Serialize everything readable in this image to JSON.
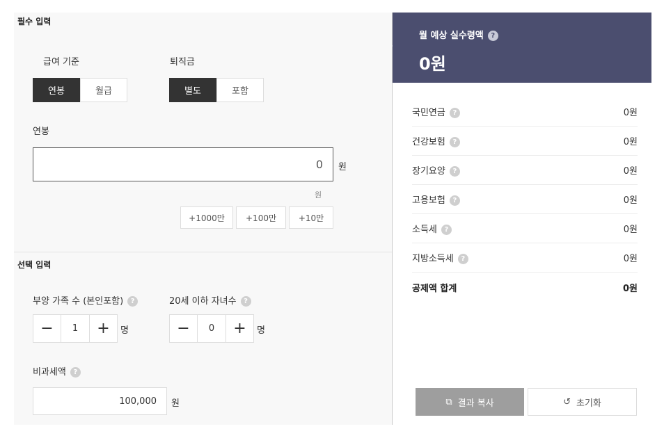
{
  "required": {
    "section_title": "필수 입력",
    "pay_basis": {
      "label": "급여 기준",
      "options": [
        "연봉",
        "월급"
      ],
      "selected": "연봉"
    },
    "severance": {
      "label": "퇴직금",
      "options": [
        "별도",
        "포함"
      ],
      "selected": "별도"
    },
    "salary": {
      "label": "연봉",
      "value": "0",
      "unit": "원",
      "sub_unit": "원"
    },
    "quick_add": [
      "+1000만",
      "+100만",
      "+10만"
    ]
  },
  "optional": {
    "section_title": "선택 입력",
    "dependents": {
      "label": "부양 가족 수 (본인포함)",
      "value": "1",
      "unit": "명"
    },
    "children": {
      "label": "20세 이하 자녀수",
      "value": "0",
      "unit": "명"
    },
    "nontaxable": {
      "label": "비과세액",
      "value": "100,000",
      "unit": "원"
    }
  },
  "result": {
    "title": "월 예상 실수령액",
    "value": "0원",
    "deductions": [
      {
        "label": "국민연금",
        "value": "0원"
      },
      {
        "label": "건강보험",
        "value": "0원"
      },
      {
        "label": "장기요양",
        "value": "0원"
      },
      {
        "label": "고용보험",
        "value": "0원"
      },
      {
        "label": "소득세",
        "value": "0원"
      },
      {
        "label": "지방소득세",
        "value": "0원"
      }
    ],
    "total": {
      "label": "공제액 합계",
      "value": "0원"
    },
    "copy_button": "결과 복사",
    "reset_button": "초기화"
  },
  "icons": {
    "help": "question-mark-icon",
    "minus": "minus-icon",
    "plus": "plus-icon",
    "copy": "copy-icon",
    "reset": "refresh-icon"
  },
  "colors": {
    "header_bg": "#4b4e6f",
    "active_bg": "#333333",
    "copy_button_bg": "#9e9e9e"
  }
}
